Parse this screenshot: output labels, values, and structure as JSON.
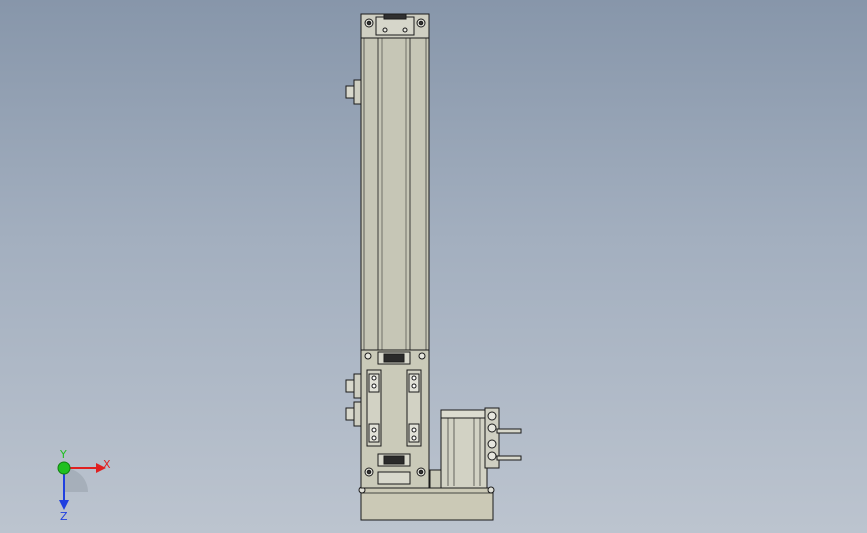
{
  "viewport": {
    "background_top": "#8796aa",
    "background_bottom": "#bcc4cf",
    "model_fill": "#c8c8b8",
    "model_stroke": "#1a1a1a",
    "motor_fill": "#d2d2c4"
  },
  "triad": {
    "x_label": "X",
    "y_label": "Y",
    "z_label": "Z",
    "x_color": "#e02020",
    "y_color": "#20c020",
    "z_color": "#2040e0"
  }
}
